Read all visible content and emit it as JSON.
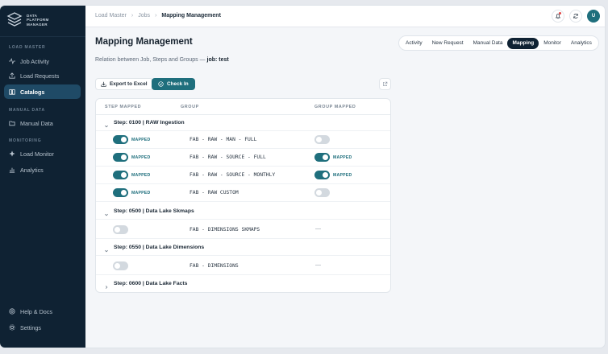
{
  "app": {
    "logo_lines": [
      "DATA",
      "PLATFORM",
      "MANAGER"
    ]
  },
  "sidebar": {
    "sections": [
      {
        "label": "LOAD MASTER"
      },
      {
        "label": "MANUAL DATA"
      },
      {
        "label": "MONITORING"
      }
    ],
    "items": [
      {
        "label": "Job Activity",
        "icon": "activity-icon",
        "active": false
      },
      {
        "label": "Load Requests",
        "icon": "upload-icon",
        "active": false
      },
      {
        "label": "Catalogs",
        "icon": "book-icon",
        "active": true
      },
      {
        "label": "Manual Data",
        "icon": "folder-icon",
        "active": false
      },
      {
        "label": "Load Monitor",
        "icon": "compass-icon",
        "active": false
      },
      {
        "label": "Analytics",
        "icon": "bar-chart-icon",
        "active": false
      },
      {
        "label": "Help & Docs",
        "icon": "help-icon",
        "active": false
      },
      {
        "label": "Settings",
        "icon": "gear-icon",
        "active": false
      }
    ]
  },
  "topbar": {
    "breadcrumbs": [
      "Load Master",
      "Jobs",
      "Mapping Management"
    ],
    "avatar_initial": "U"
  },
  "page": {
    "title": "Mapping Management",
    "subtitle_prefix": "Relation between Job, Steps and Groups — ",
    "subtitle_job": "job: test"
  },
  "tabs": [
    {
      "label": "Activity",
      "active": false
    },
    {
      "label": "New Request",
      "active": false
    },
    {
      "label": "Manual Data",
      "active": false
    },
    {
      "label": "Mapping",
      "active": true
    },
    {
      "label": "Monitor",
      "active": false
    },
    {
      "label": "Analytics",
      "active": false
    }
  ],
  "actions": {
    "export_label": "Export to Excel",
    "checkin_label": "Check In"
  },
  "table": {
    "headers": {
      "step_mapped": "STEP MAPPED",
      "group": "GROUP",
      "group_mapped": "GROUP MAPPED"
    },
    "mapped_label": "MAPPED",
    "empty_marker": "—",
    "steps": [
      {
        "title": "Step: 0100 | RAW Ingestion",
        "expanded": true,
        "rows": [
          {
            "step_mapped": true,
            "group": "FAB - RAW - MAN - FULL",
            "group_mapped": false
          },
          {
            "step_mapped": true,
            "group": "FAB - RAW - SOURCE - FULL",
            "group_mapped": true
          },
          {
            "step_mapped": true,
            "group": "FAB - RAW - SOURCE - MONTHLY",
            "group_mapped": true
          },
          {
            "step_mapped": true,
            "group": "FAB - RAW CUSTOM",
            "group_mapped": false
          }
        ]
      },
      {
        "title": "Step: 0500 | Data Lake Skmaps",
        "expanded": true,
        "rows": [
          {
            "step_mapped": false,
            "group": "FAB - DIMENSIONS SKMAPS",
            "group_mapped": null
          }
        ]
      },
      {
        "title": "Step: 0550 | Data Lake Dimensions",
        "expanded": true,
        "rows": [
          {
            "step_mapped": false,
            "group": "FAB - DIMENSIONS",
            "group_mapped": null
          }
        ]
      },
      {
        "title": "Step: 0600 | Data Lake Facts",
        "expanded": false,
        "rows": []
      }
    ]
  }
}
